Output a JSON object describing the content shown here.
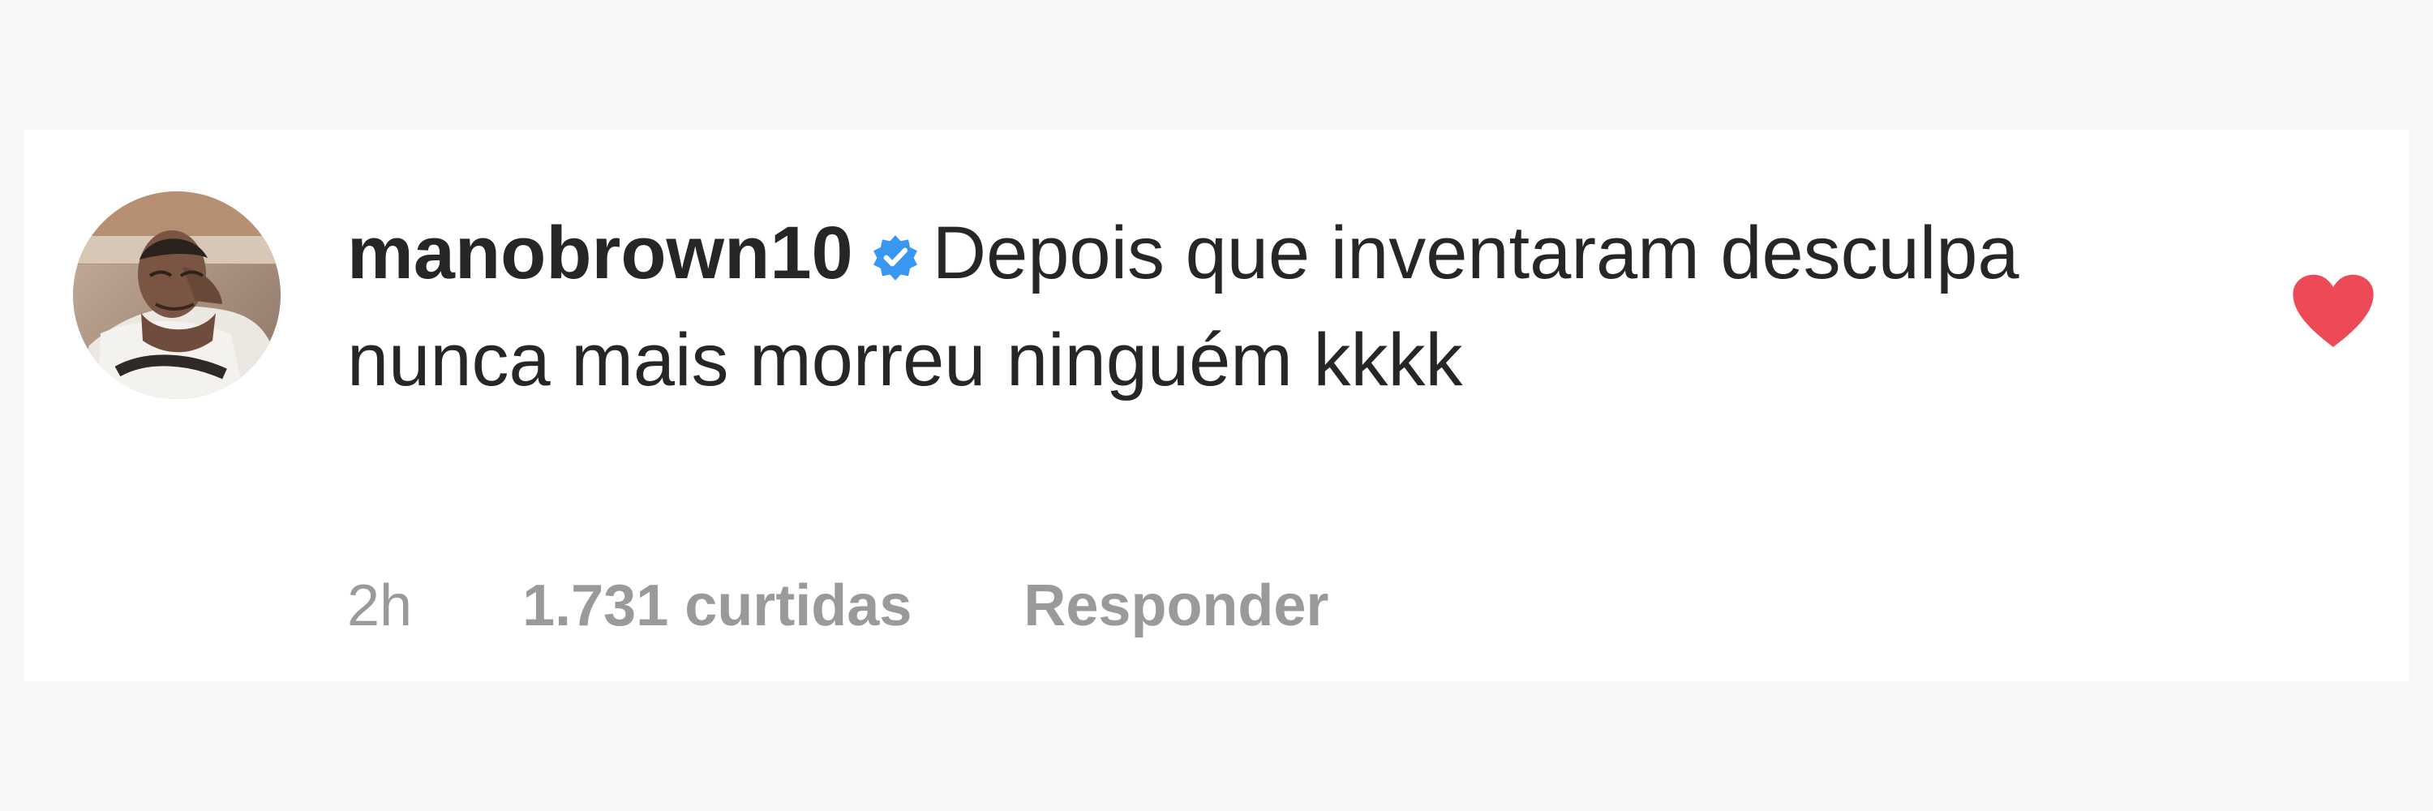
{
  "comment": {
    "username": "manobrown10",
    "text": "Depois que inventaram desculpa nunca mais morreu ninguém kkkk",
    "timestamp": "2h",
    "likes_label": "1.731 curtidas",
    "reply_label": "Responder"
  },
  "icons": {
    "verified": "verified-badge-icon",
    "like": "heart-icon"
  },
  "colors": {
    "page_background": "#f7f7f7",
    "card_background": "#ffffff",
    "primary_text": "#262626",
    "secondary_text": "#9a9a9a",
    "verified_blue": "#3897f0",
    "heart_red": "#ed4956"
  }
}
